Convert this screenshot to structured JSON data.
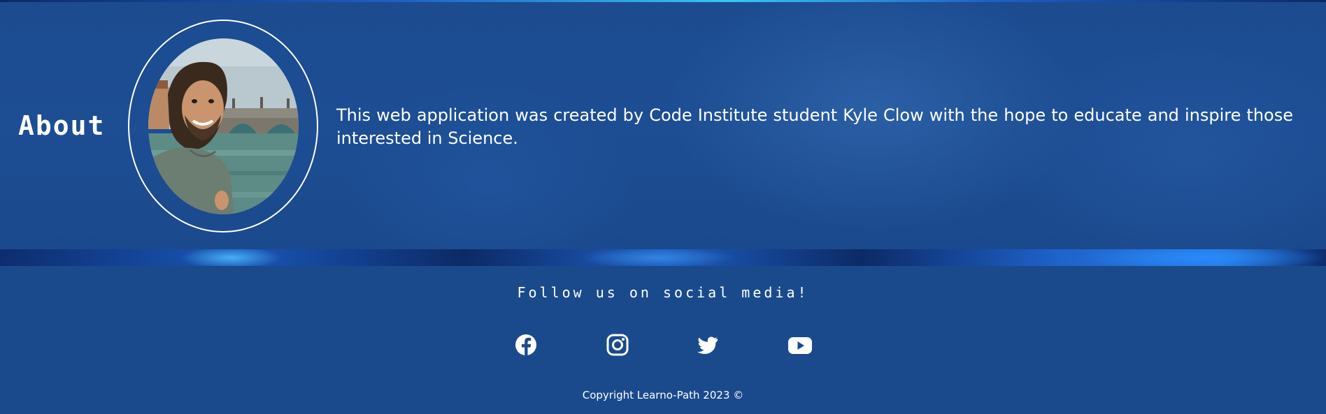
{
  "about": {
    "title": "About",
    "photo": "profile-photo-kyle-clow",
    "text": "This web application was created by Code Institute student Kyle Clow with the hope to educate and inspire those interested in Science."
  },
  "footer": {
    "follow_text": "Follow us on social media!",
    "social": [
      {
        "icon": "facebook-icon"
      },
      {
        "icon": "instagram-icon"
      },
      {
        "icon": "twitter-icon"
      },
      {
        "icon": "youtube-icon"
      }
    ],
    "copyright": "Copyright Learno-Path 2023 ©"
  },
  "colors": {
    "background": "#1a4a8c",
    "text": "#ffffff",
    "accent": "#38c6f0"
  }
}
